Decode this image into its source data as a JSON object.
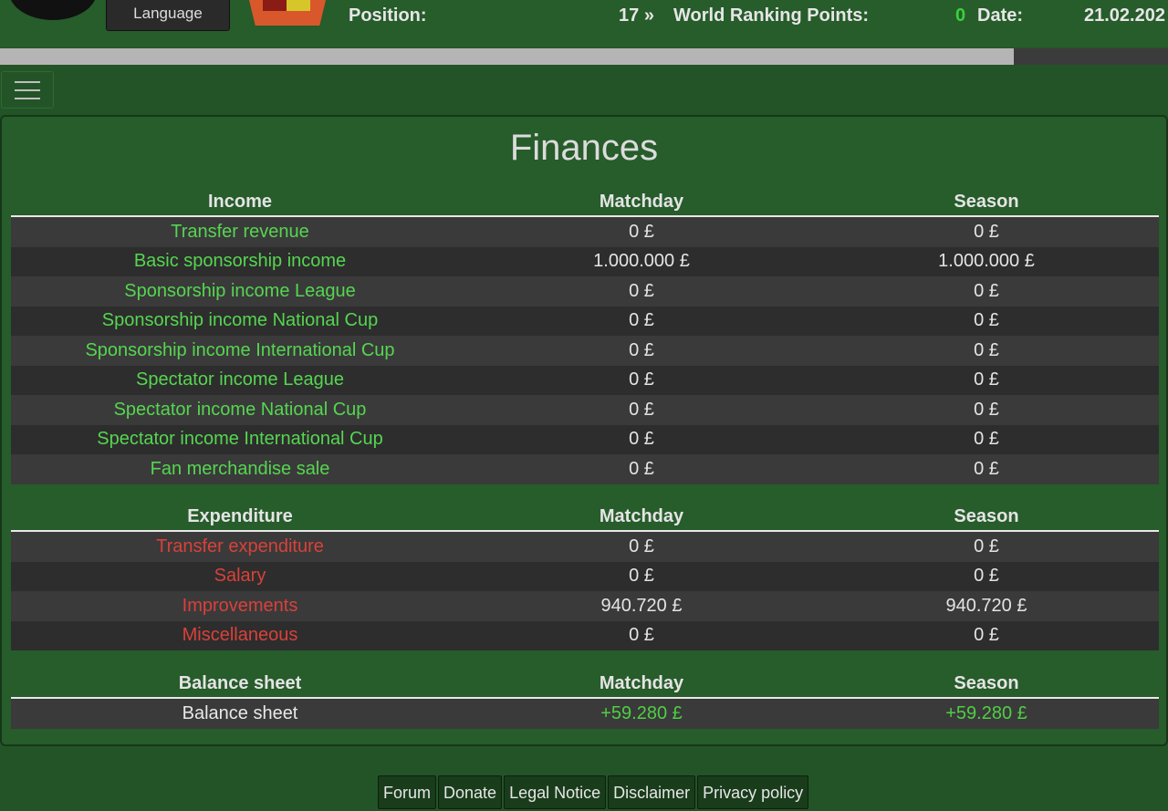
{
  "header": {
    "language_label": "Language",
    "position_label": "Position:",
    "position_value": "17",
    "chevron": "»",
    "ranking_label": "World Ranking Points:",
    "ranking_value": "0",
    "date_label": "Date:",
    "date_value": "21.02.202",
    "progress_fraction": 0.868
  },
  "colors": {
    "background": "#235427",
    "panel": "#275c2b",
    "income_label": "#55d650",
    "expenditure_label": "#d9413a",
    "positive_value": "#4fcf44",
    "row_light": "#3a3a3a",
    "row_dark": "#2d2d2d"
  },
  "icons": [
    "club-logo-icon",
    "club-crest-icon",
    "hamburger-menu-icon"
  ],
  "page_title": "Finances",
  "income": {
    "headers": [
      "Income",
      "Matchday",
      "Season"
    ],
    "rows": [
      {
        "label": "Transfer revenue",
        "matchday": "0 £",
        "season": "0 £"
      },
      {
        "label": "Basic sponsorship income",
        "matchday": "1.000.000 £",
        "season": "1.000.000 £"
      },
      {
        "label": "Sponsorship income League",
        "matchday": "0 £",
        "season": "0 £"
      },
      {
        "label": "Sponsorship income National Cup",
        "matchday": "0 £",
        "season": "0 £"
      },
      {
        "label": "Sponsorship income International Cup",
        "matchday": "0 £",
        "season": "0 £"
      },
      {
        "label": "Spectator income League",
        "matchday": "0 £",
        "season": "0 £"
      },
      {
        "label": "Spectator income National Cup",
        "matchday": "0 £",
        "season": "0 £"
      },
      {
        "label": "Spectator income International Cup",
        "matchday": "0 £",
        "season": "0 £"
      },
      {
        "label": "Fan merchandise sale",
        "matchday": "0 £",
        "season": "0 £"
      }
    ]
  },
  "expenditure": {
    "headers": [
      "Expenditure",
      "Matchday",
      "Season"
    ],
    "rows": [
      {
        "label": "Transfer expenditure",
        "matchday": "0 £",
        "season": "0 £"
      },
      {
        "label": "Salary",
        "matchday": "0 £",
        "season": "0 £"
      },
      {
        "label": "Improvements",
        "matchday": "940.720 £",
        "season": "940.720 £"
      },
      {
        "label": "Miscellaneous",
        "matchday": "0 £",
        "season": "0 £"
      }
    ]
  },
  "balance": {
    "headers": [
      "Balance sheet",
      "Matchday",
      "Season"
    ],
    "rows": [
      {
        "label": "Balance sheet",
        "matchday": "+59.280 £",
        "season": "+59.280 £"
      }
    ]
  },
  "footer": {
    "links": [
      "Forum",
      "Donate",
      "Legal Notice",
      "Disclaimer",
      "Privacy policy"
    ]
  }
}
